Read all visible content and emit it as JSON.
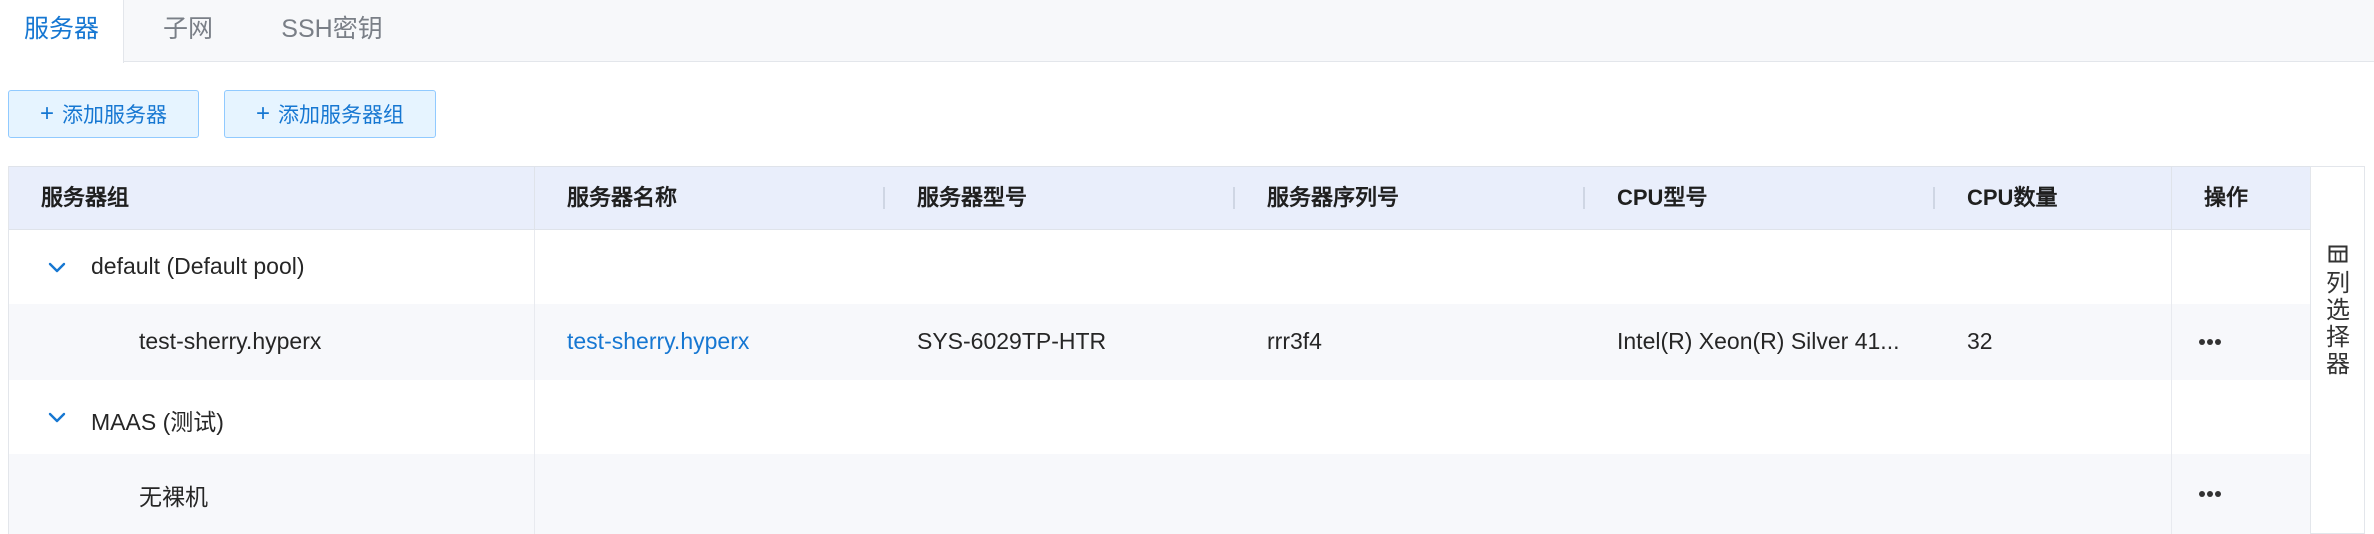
{
  "tabs": [
    {
      "label": "服务器",
      "active": true
    },
    {
      "label": "子网",
      "active": false
    },
    {
      "label": "SSH密钥",
      "active": false
    }
  ],
  "toolbar": {
    "add_server_label": "添加服务器",
    "add_group_label": "添加服务器组"
  },
  "table": {
    "columns": [
      "服务器组",
      "服务器名称",
      "服务器型号",
      "服务器序列号",
      "CPU型号",
      "CPU数量",
      "操作"
    ],
    "groups": [
      {
        "name": "default (Default pool)",
        "expanded": true,
        "servers": [
          {
            "group_cell": "test-sherry.hyperx",
            "name": "test-sherry.hyperx",
            "model": "SYS-6029TP-HTR",
            "serial": "rrr3f4",
            "cpu_model": "Intel(R) Xeon(R) Silver 41...",
            "cpu_count": "32"
          }
        ]
      },
      {
        "name": "MAAS (测试)",
        "expanded": true,
        "servers": [
          {
            "group_cell": "无裸机"
          }
        ]
      }
    ]
  },
  "column_chooser": {
    "label": "列选择器"
  },
  "colors": {
    "accent": "#1677d2",
    "header_bg": "#e9eefb",
    "button_bg": "#e6f4ff"
  }
}
